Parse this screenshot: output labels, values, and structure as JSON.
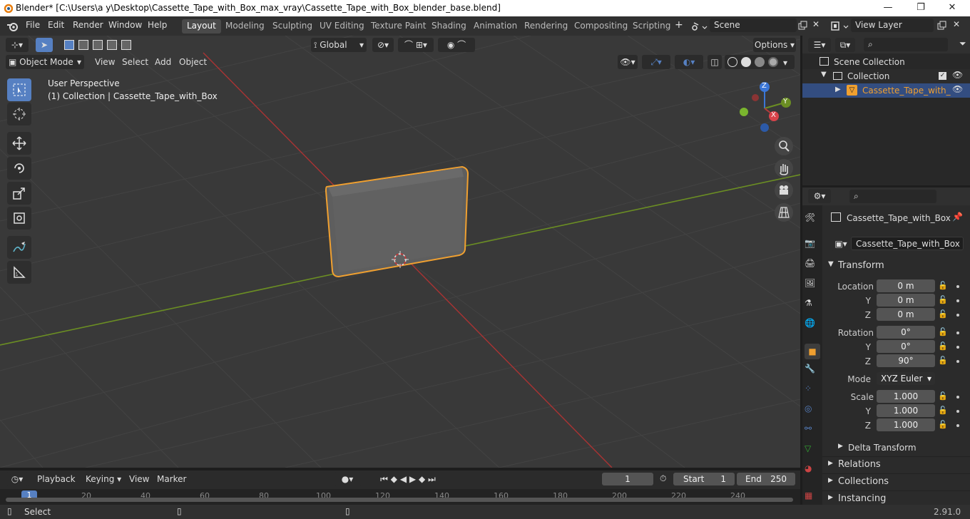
{
  "window": {
    "title": "Blender* [C:\\Users\\a y\\Desktop\\Cassette_Tape_with_Box_max_vray\\Cassette_Tape_with_Box_blender_base.blend]",
    "minimize": "—",
    "maximize": "❐",
    "close": "✕"
  },
  "menu": [
    "File",
    "Edit",
    "Render",
    "Window",
    "Help"
  ],
  "workspaces": [
    "Layout",
    "Modeling",
    "Sculpting",
    "UV Editing",
    "Texture Paint",
    "Shading",
    "Animation",
    "Rendering",
    "Compositing",
    "Scripting"
  ],
  "add_workspace": "+",
  "scene": "Scene",
  "view_layer": "View Layer",
  "viewport": {
    "orientation": "Global",
    "options": "Options",
    "mode": "Object Mode",
    "menus": [
      "View",
      "Select",
      "Add",
      "Object"
    ],
    "info_line1": "User Perspective",
    "info_line2": "(1) Collection | Cassette_Tape_with_Box",
    "gizmo": {
      "x": "X",
      "y": "Y",
      "z": "Z"
    }
  },
  "outliner": {
    "scene_collection": "Scene Collection",
    "collection": "Collection",
    "object": "Cassette_Tape_with_"
  },
  "properties": {
    "object_name": "Cassette_Tape_with_Box",
    "object_field": "Cassette_Tape_with_Box",
    "transform_label": "Transform",
    "location_x_label": "Location X",
    "y_label": "Y",
    "z_label": "Z",
    "location": [
      "0 m",
      "0 m",
      "0 m"
    ],
    "rotation_x_label": "Rotation X",
    "rotation": [
      "0°",
      "0°",
      "90°"
    ],
    "mode_label": "Mode",
    "mode_value": "XYZ Euler",
    "scale_x_label": "Scale X",
    "scale": [
      "1.000",
      "1.000",
      "1.000"
    ],
    "delta_transform": "Delta Transform",
    "relations": "Relations",
    "collections": "Collections",
    "instancing": "Instancing"
  },
  "timeline": {
    "playback": "Playback",
    "keying": "Keying",
    "view": "View",
    "marker": "Marker",
    "current_frame": "1",
    "start_label": "Start",
    "start_value": "1",
    "end_label": "End",
    "end_value": "250",
    "ruler": [
      "1",
      "20",
      "40",
      "60",
      "80",
      "100",
      "120",
      "140",
      "160",
      "180",
      "200",
      "220",
      "240"
    ]
  },
  "status": {
    "select": "Select",
    "version": "2.91.0"
  },
  "colors": {
    "accent_blue": "#5680c2",
    "selection_orange": "#f0a030",
    "x_axis": "#b53b3b",
    "y_axis": "#6b8e23",
    "z_axis": "#3b76d6"
  }
}
